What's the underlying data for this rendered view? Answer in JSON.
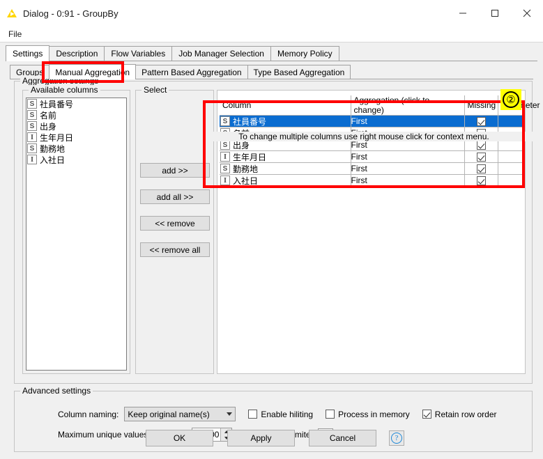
{
  "window": {
    "title": "Dialog - 0:91 - GroupBy",
    "app_icon": "knime-triangle-icon",
    "minimize_label": "—",
    "maximize_label": "□",
    "close_label": "✕"
  },
  "menubar": {
    "items": [
      {
        "label": "File"
      }
    ]
  },
  "outer_tabs": [
    {
      "label": "Settings",
      "active": true
    },
    {
      "label": "Description",
      "active": false
    },
    {
      "label": "Flow Variables",
      "active": false
    },
    {
      "label": "Job Manager Selection",
      "active": false
    },
    {
      "label": "Memory Policy",
      "active": false
    }
  ],
  "inner_tabs": [
    {
      "label": "Groups",
      "active": false
    },
    {
      "label": "Manual Aggregation",
      "active": true
    },
    {
      "label": "Pattern Based Aggregation",
      "active": false
    },
    {
      "label": "Type Based Aggregation",
      "active": false
    }
  ],
  "aggregation_settings": {
    "legend": "Aggregation settings",
    "available_columns": {
      "legend": "Available columns",
      "items": [
        {
          "type": "S",
          "label": "社員番号"
        },
        {
          "type": "S",
          "label": "名前"
        },
        {
          "type": "S",
          "label": "出身"
        },
        {
          "type": "I",
          "label": "生年月日"
        },
        {
          "type": "S",
          "label": "勤務地"
        },
        {
          "type": "I",
          "label": "入社日"
        }
      ]
    },
    "select": {
      "legend": "Select",
      "buttons": [
        {
          "label": "add >>"
        },
        {
          "label": "add all >>"
        },
        {
          "label": "<< remove"
        },
        {
          "label": "<< remove all"
        }
      ]
    },
    "table": {
      "hint": "To change multiple columns use right mouse click for context menu.",
      "headers": [
        "Column",
        "Aggregation (click to change)",
        "Missing",
        "Parameter"
      ],
      "rows": [
        {
          "type": "S",
          "column": "社員番号",
          "aggregation": "First",
          "missing": true,
          "parameter": "",
          "selected": true
        },
        {
          "type": "S",
          "column": "名前",
          "aggregation": "First",
          "missing": true,
          "parameter": "",
          "selected": false
        },
        {
          "type": "S",
          "column": "出身",
          "aggregation": "First",
          "missing": true,
          "parameter": "",
          "selected": false
        },
        {
          "type": "I",
          "column": "生年月日",
          "aggregation": "First",
          "missing": true,
          "parameter": "",
          "selected": false
        },
        {
          "type": "S",
          "column": "勤務地",
          "aggregation": "First",
          "missing": true,
          "parameter": "",
          "selected": false
        },
        {
          "type": "I",
          "column": "入社日",
          "aggregation": "First",
          "missing": true,
          "parameter": "",
          "selected": false
        }
      ]
    }
  },
  "annotations": {
    "badge_number": "②",
    "highlight_color": "#ffff00",
    "box_color": "#ff0000"
  },
  "advanced_settings": {
    "legend": "Advanced settings",
    "column_naming_label": "Column naming:",
    "column_naming_value": "Keep original name(s)",
    "enable_hiliting_label": "Enable hiliting",
    "enable_hiliting_checked": false,
    "process_in_memory_label": "Process in memory",
    "process_in_memory_checked": false,
    "retain_row_order_label": "Retain row order",
    "retain_row_order_checked": true,
    "max_unique_label": "Maximum unique values per group",
    "max_unique_value": "10,000",
    "value_delimiter_label": "Value delimiter",
    "value_delimiter_value": ","
  },
  "footer": {
    "ok_label": "OK",
    "apply_label": "Apply",
    "cancel_label": "Cancel",
    "help_label": "?"
  }
}
